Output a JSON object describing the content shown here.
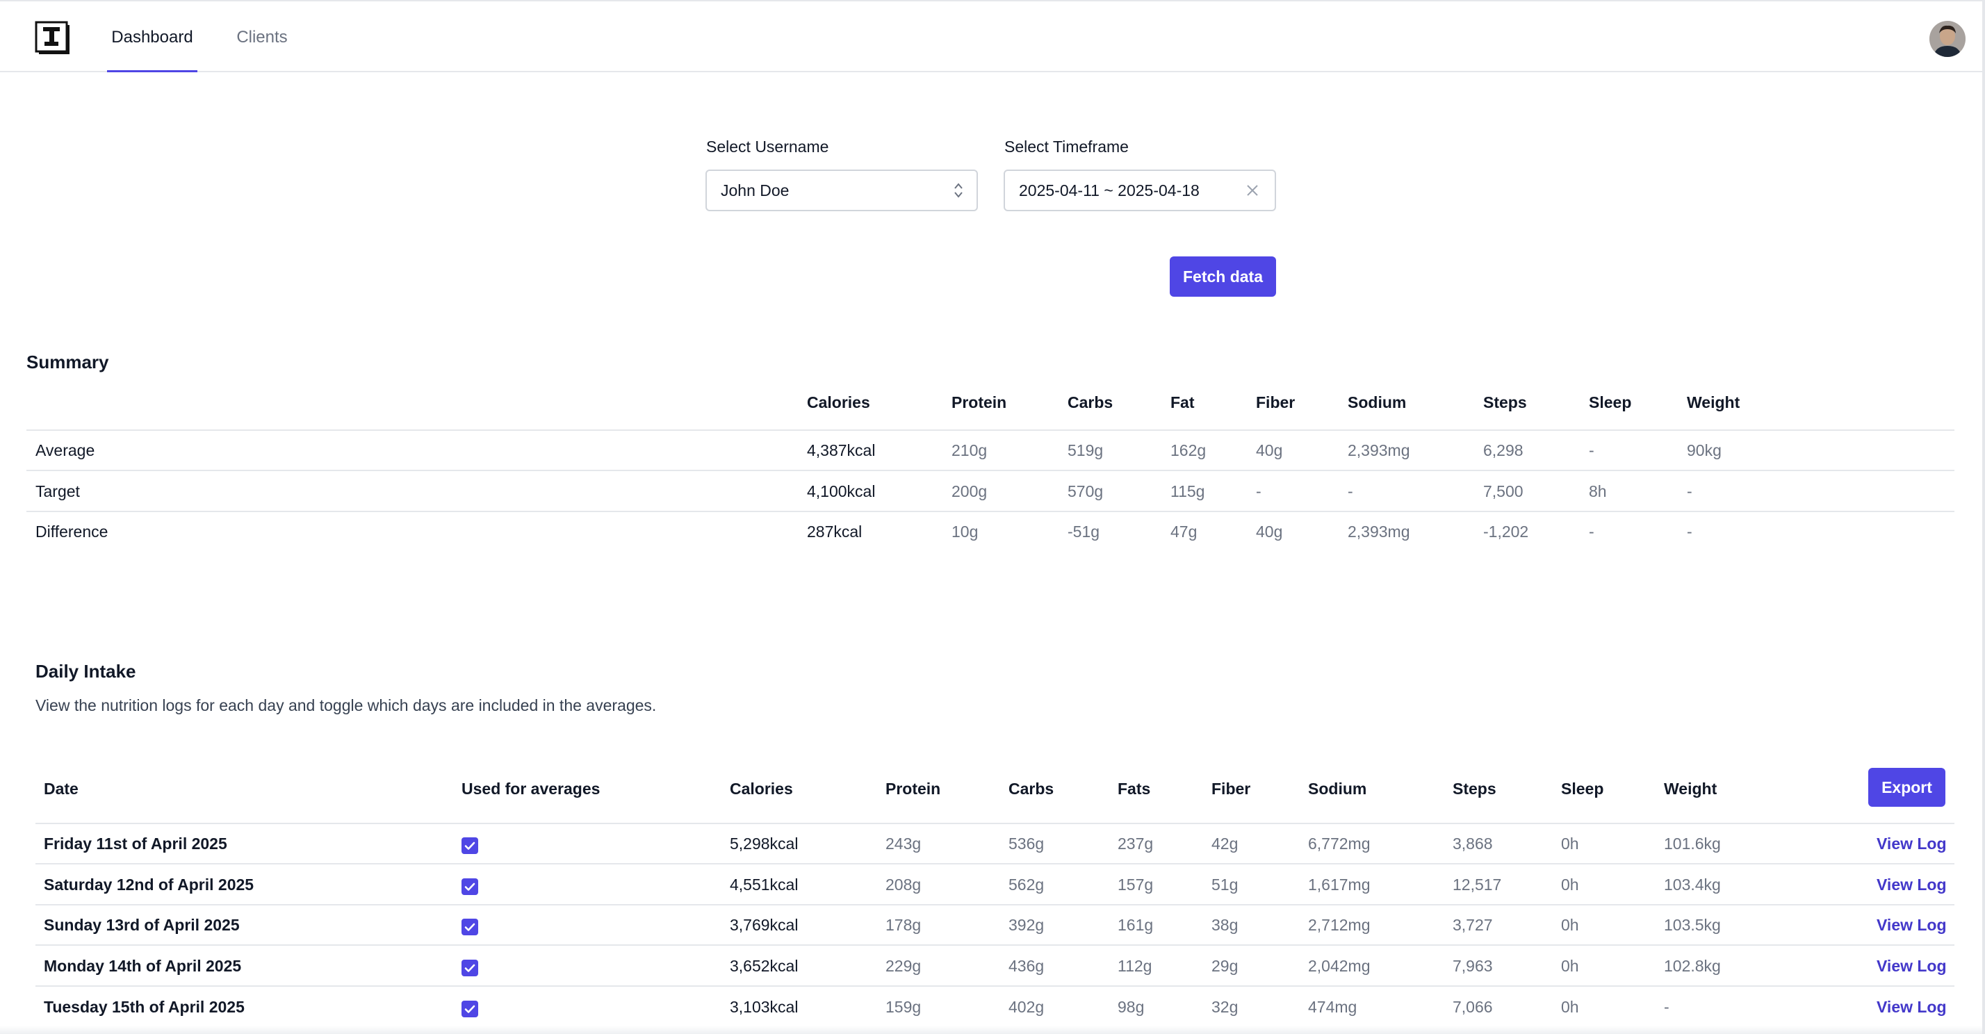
{
  "nav": {
    "tabs": [
      "Dashboard",
      "Clients"
    ],
    "active_tab": "Dashboard"
  },
  "filters": {
    "username_label": "Select Username",
    "username_value": "John Doe",
    "timeframe_label": "Select Timeframe",
    "timeframe_value": "2025-04-11 ~ 2025-04-18",
    "fetch_button": "Fetch data"
  },
  "summary": {
    "title": "Summary",
    "columns": [
      "Calories",
      "Protein",
      "Carbs",
      "Fat",
      "Fiber",
      "Sodium",
      "Steps",
      "Sleep",
      "Weight"
    ],
    "rows": [
      {
        "label": "Average",
        "values": [
          "4,387kcal",
          "210g",
          "519g",
          "162g",
          "40g",
          "2,393mg",
          "6,298",
          "-",
          "90kg"
        ]
      },
      {
        "label": "Target",
        "values": [
          "4,100kcal",
          "200g",
          "570g",
          "115g",
          "-",
          "-",
          "7,500",
          "8h",
          "-"
        ]
      },
      {
        "label": "Difference",
        "values": [
          "287kcal",
          "10g",
          "-51g",
          "47g",
          "40g",
          "2,393mg",
          "-1,202",
          "-",
          "-"
        ]
      }
    ]
  },
  "daily": {
    "title": "Daily Intake",
    "description": "View the nutrition logs for each day and toggle which days are included in the averages.",
    "columns": [
      "Date",
      "Used for averages",
      "Calories",
      "Protein",
      "Carbs",
      "Fats",
      "Fiber",
      "Sodium",
      "Steps",
      "Sleep",
      "Weight"
    ],
    "export_button": "Export",
    "view_log_label": "View Log",
    "rows": [
      {
        "date": "Friday 11st of April 2025",
        "used": true,
        "values": [
          "5,298kcal",
          "243g",
          "536g",
          "237g",
          "42g",
          "6,772mg",
          "3,868",
          "0h",
          "101.6kg"
        ]
      },
      {
        "date": "Saturday 12nd of April 2025",
        "used": true,
        "values": [
          "4,551kcal",
          "208g",
          "562g",
          "157g",
          "51g",
          "1,617mg",
          "12,517",
          "0h",
          "103.4kg"
        ]
      },
      {
        "date": "Sunday 13rd of April 2025",
        "used": true,
        "values": [
          "3,769kcal",
          "178g",
          "392g",
          "161g",
          "38g",
          "2,712mg",
          "3,727",
          "0h",
          "103.5kg"
        ]
      },
      {
        "date": "Monday 14th of April 2025",
        "used": true,
        "values": [
          "3,652kcal",
          "229g",
          "436g",
          "112g",
          "29g",
          "2,042mg",
          "7,963",
          "0h",
          "102.8kg"
        ]
      },
      {
        "date": "Tuesday 15th of April 2025",
        "used": true,
        "values": [
          "3,103kcal",
          "159g",
          "402g",
          "98g",
          "32g",
          "474mg",
          "7,066",
          "0h",
          "-"
        ]
      }
    ]
  },
  "colors": {
    "accent": "#4f46e5",
    "link": "#4338ca",
    "muted_text": "#6b7280",
    "border": "#e5e7eb"
  }
}
